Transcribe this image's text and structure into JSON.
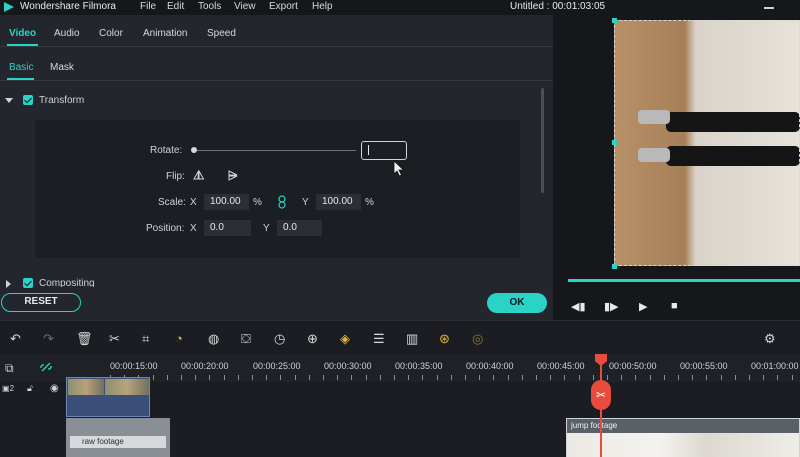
{
  "titlebar": {
    "app_name": "Wondershare Filmora",
    "menu": [
      "File",
      "Edit",
      "Tools",
      "View",
      "Export",
      "Help"
    ],
    "document": "Untitled : 00:01:03:05"
  },
  "tabs": [
    "Video",
    "Audio",
    "Color",
    "Animation",
    "Speed"
  ],
  "subtabs": [
    "Basic",
    "Mask"
  ],
  "sections": {
    "transform": "Transform",
    "compositing": "Compositing"
  },
  "transform": {
    "rotate_label": "Rotate:",
    "flip_label": "Flip:",
    "scale_label": "Scale:",
    "scale_x_label": "X",
    "scale_x_value": "100.00",
    "scale_x_unit": "%",
    "scale_y_label": "Y",
    "scale_y_value": "100.00",
    "scale_y_unit": "%",
    "position_label": "Position:",
    "pos_x_label": "X",
    "pos_x_value": "0.0",
    "pos_y_label": "Y",
    "pos_y_value": "0.0"
  },
  "buttons": {
    "reset": "RESET",
    "ok": "OK"
  },
  "timeline": {
    "timecodes": [
      "00:00:15:00",
      "00:00:20:00",
      "00:00:25:00",
      "00:00:30:00",
      "00:00:35:00",
      "00:00:40:00",
      "00:00:45:00",
      "00:00:50:00",
      "00:00:55:00",
      "00:01:00:00"
    ],
    "track_number": "2",
    "clip_raw": "raw footage",
    "clip_jump": "jump footage"
  },
  "colors": {
    "accent": "#29d3c7",
    "playhead": "#e74c3c",
    "panel": "#23272d"
  },
  "icons": [
    "filmora-logo-icon",
    "undo-icon",
    "redo-icon",
    "delete-icon",
    "cut-icon",
    "crop-icon",
    "speed-icon",
    "color-icon",
    "stabilize-icon",
    "duration-icon",
    "zoom-icon",
    "keyframe-icon",
    "adjust-icon",
    "audio-icon",
    "motion-icon",
    "render-icon",
    "link-icon",
    "lock-icon",
    "eye-icon",
    "play-icon",
    "stop-icon"
  ]
}
